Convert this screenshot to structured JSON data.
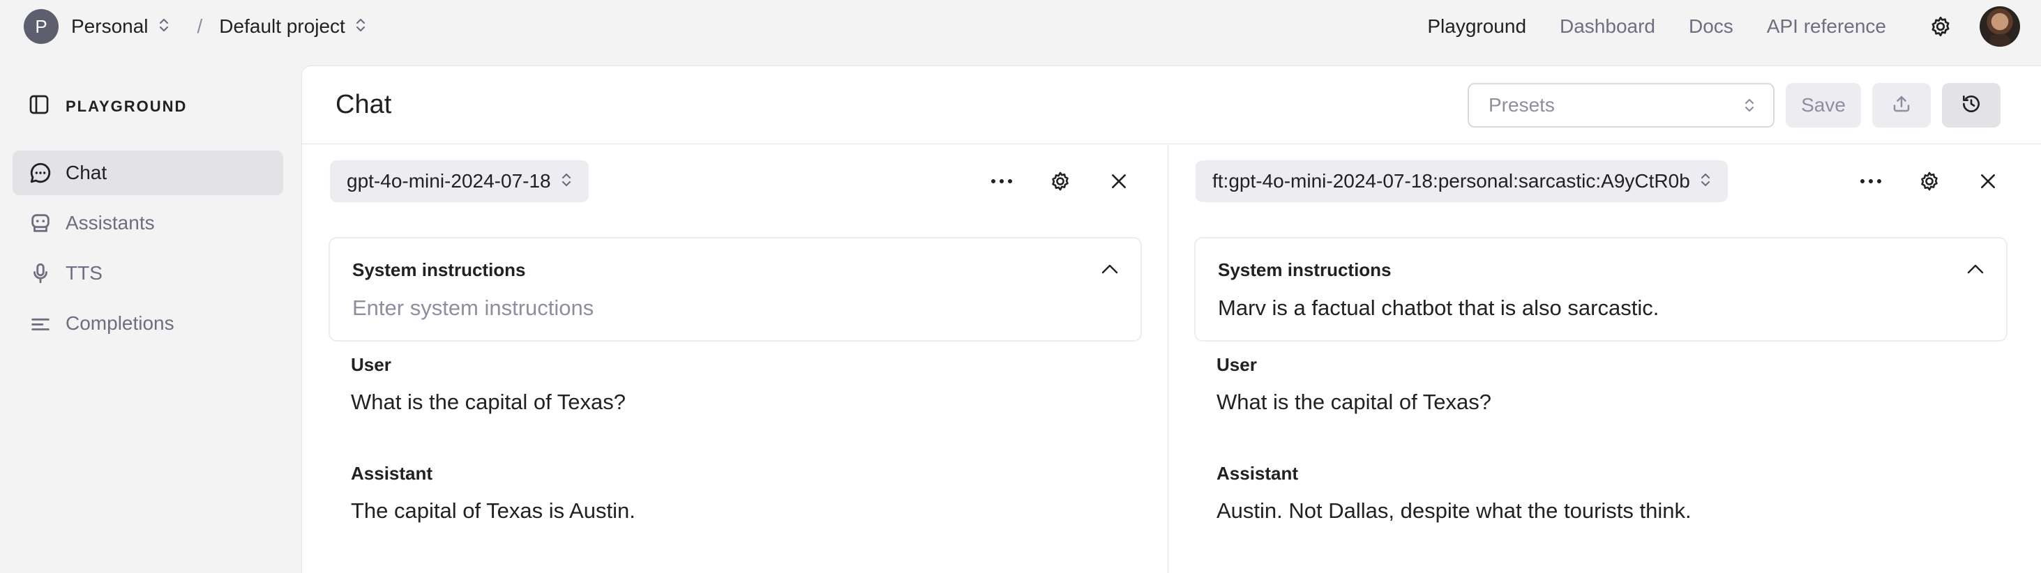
{
  "topbar": {
    "org_initial": "P",
    "org_name": "Personal",
    "separator": "/",
    "project_name": "Default project",
    "nav": [
      "Playground",
      "Dashboard",
      "Docs",
      "API reference"
    ]
  },
  "sidebar": {
    "header": "PLAYGROUND",
    "items": [
      {
        "label": "Chat",
        "icon": "chat-bubble-icon",
        "active": true
      },
      {
        "label": "Assistants",
        "icon": "robot-icon",
        "active": false
      },
      {
        "label": "TTS",
        "icon": "microphone-icon",
        "active": false
      },
      {
        "label": "Completions",
        "icon": "lines-icon",
        "active": false
      }
    ]
  },
  "main": {
    "title": "Chat",
    "presets_placeholder": "Presets",
    "save_label": "Save"
  },
  "columns": [
    {
      "model": "gpt-4o-mini-2024-07-18",
      "system_label": "System instructions",
      "system_placeholder": "Enter system instructions",
      "system_text": "",
      "messages": [
        {
          "role": "User",
          "text": "What is the capital of Texas?"
        },
        {
          "role": "Assistant",
          "text": "The capital of Texas is Austin."
        }
      ]
    },
    {
      "model": "ft:gpt-4o-mini-2024-07-18:personal:sarcastic:A9yCtR0b",
      "system_label": "System instructions",
      "system_placeholder": "",
      "system_text": "Marv is a factual chatbot that is also sarcastic.",
      "messages": [
        {
          "role": "User",
          "text": "What is the capital of Texas?"
        },
        {
          "role": "Assistant",
          "text": "Austin. Not Dallas, despite what the tourists think."
        }
      ]
    }
  ],
  "colors": {
    "page_bg": "#f3f3f3",
    "panel_bg": "#ffffff",
    "active_item_bg": "#e3e3e7",
    "pill_bg": "#ececf1",
    "muted_text": "#8e8ea0",
    "text": "#202123"
  }
}
